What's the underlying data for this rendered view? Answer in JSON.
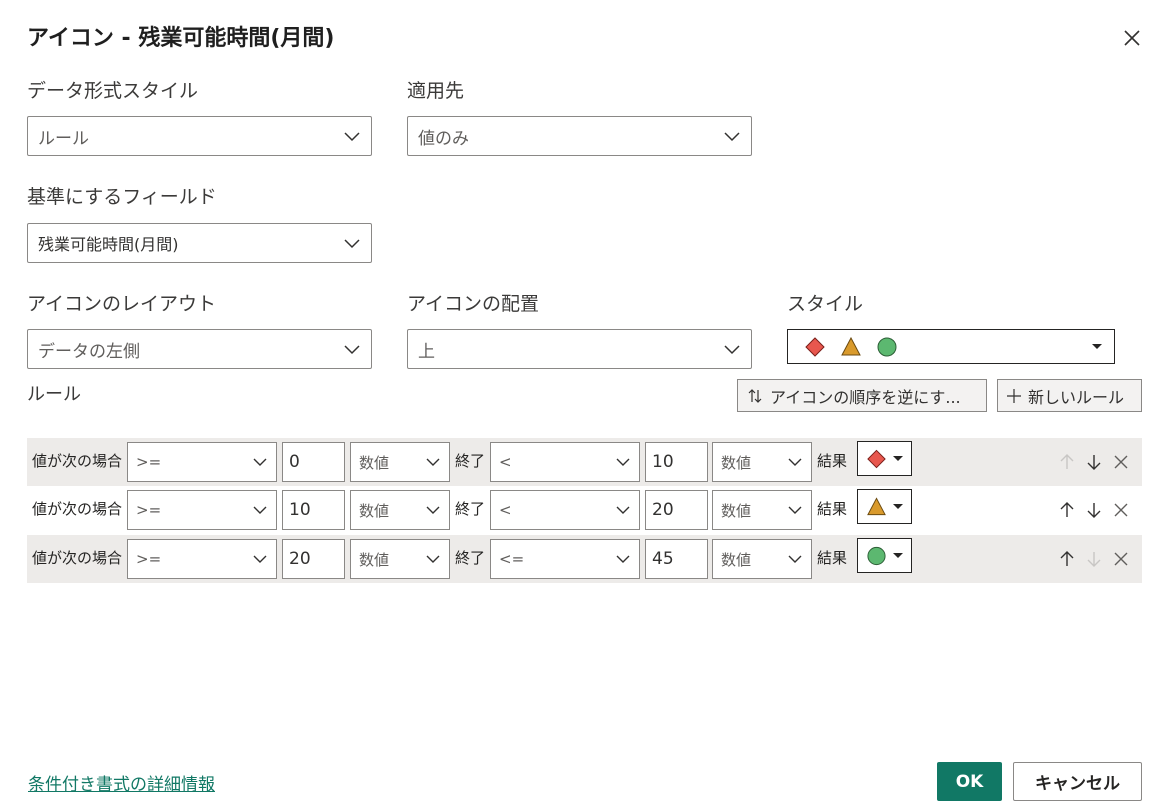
{
  "dialog": {
    "title": "アイコン - 残業可能時間(月間)"
  },
  "fields": {
    "format_style": {
      "label": "データ形式スタイル",
      "value": "ルール"
    },
    "apply_to": {
      "label": "適用先",
      "value": "値のみ"
    },
    "based_on_field": {
      "label": "基準にするフィールド",
      "value": "残業可能時間(月間)"
    },
    "icon_layout": {
      "label": "アイコンのレイアウト",
      "value": "データの左側"
    },
    "icon_alignment": {
      "label": "アイコンの配置",
      "value": "上"
    },
    "style": {
      "label": "スタイル",
      "icons": [
        "red-diamond-icon",
        "yellow-triangle-icon",
        "green-circle-icon"
      ]
    }
  },
  "rules": {
    "label": "ルール",
    "reverse_button": "アイコンの順序を逆にす...",
    "new_rule_button": "新しいルール",
    "if_label": "値が次の場合",
    "end_label": "終了",
    "result_label": "結果",
    "rows": [
      {
        "op1": ">=",
        "val1": "0",
        "type1": "数値",
        "op2": "<",
        "val2": "10",
        "type2": "数値",
        "icon": "red-diamond-icon",
        "shaded": true
      },
      {
        "op1": ">=",
        "val1": "10",
        "type1": "数値",
        "op2": "<",
        "val2": "20",
        "type2": "数値",
        "icon": "yellow-triangle-icon",
        "shaded": false
      },
      {
        "op1": ">=",
        "val1": "20",
        "type1": "数値",
        "op2": "<=",
        "val2": "45",
        "type2": "数値",
        "icon": "green-circle-icon",
        "shaded": true
      }
    ]
  },
  "footer": {
    "learn_more_link": "条件付き書式の詳細情報",
    "ok_button": "OK",
    "cancel_button": "キャンセル"
  },
  "colors": {
    "accent": "#117865",
    "red_icon": "#e8574e",
    "yellow_icon": "#d99a2c",
    "green_icon": "#5cb870"
  }
}
